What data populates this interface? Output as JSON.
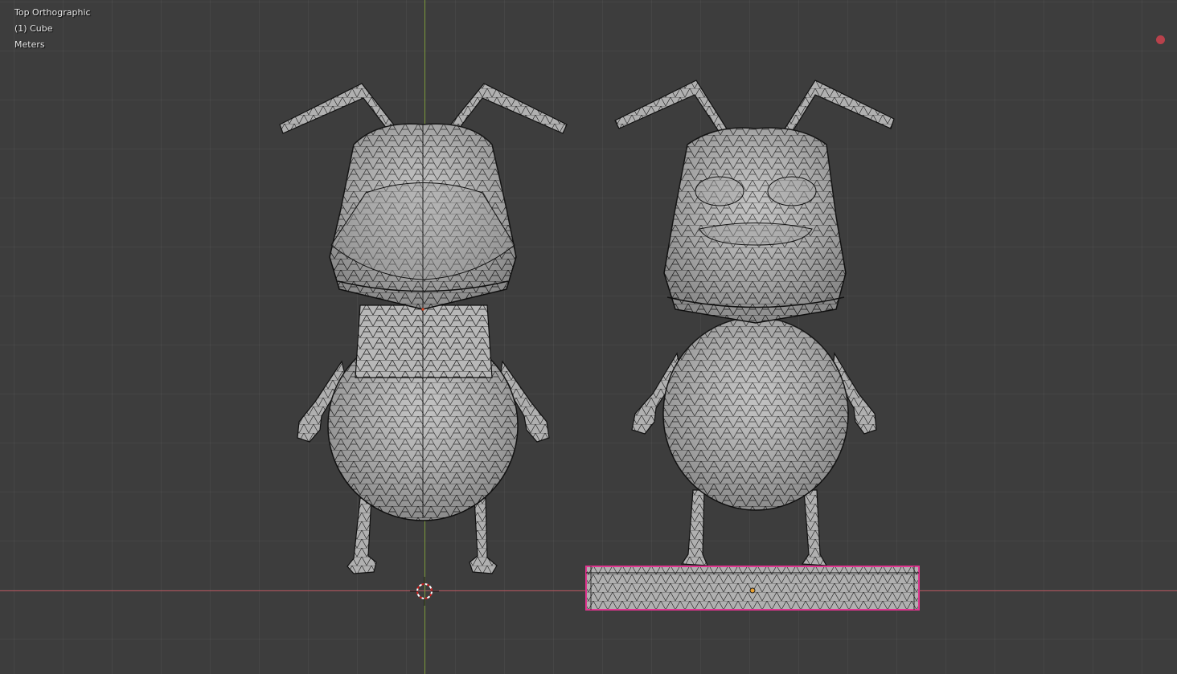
{
  "viewport": {
    "view_name": "Top Orthographic",
    "object_name": "(1) Cube",
    "units": "Meters"
  },
  "scene": {
    "objects": [
      {
        "name": "character-front",
        "selected": false
      },
      {
        "name": "character-back",
        "selected": false
      },
      {
        "name": "base-plate",
        "selected": true
      }
    ],
    "colors": {
      "background": "#3d3d3d",
      "mesh_fill": "#b5b5b5",
      "wire": "#111111",
      "selection_outline": "#e0358f",
      "x_axis": "#b2515a",
      "y_axis": "#7c9a3b",
      "record_indicator": "#b8414b"
    },
    "icons": [
      "3d-cursor-icon",
      "origin-point-icon",
      "record-indicator-icon"
    ]
  }
}
